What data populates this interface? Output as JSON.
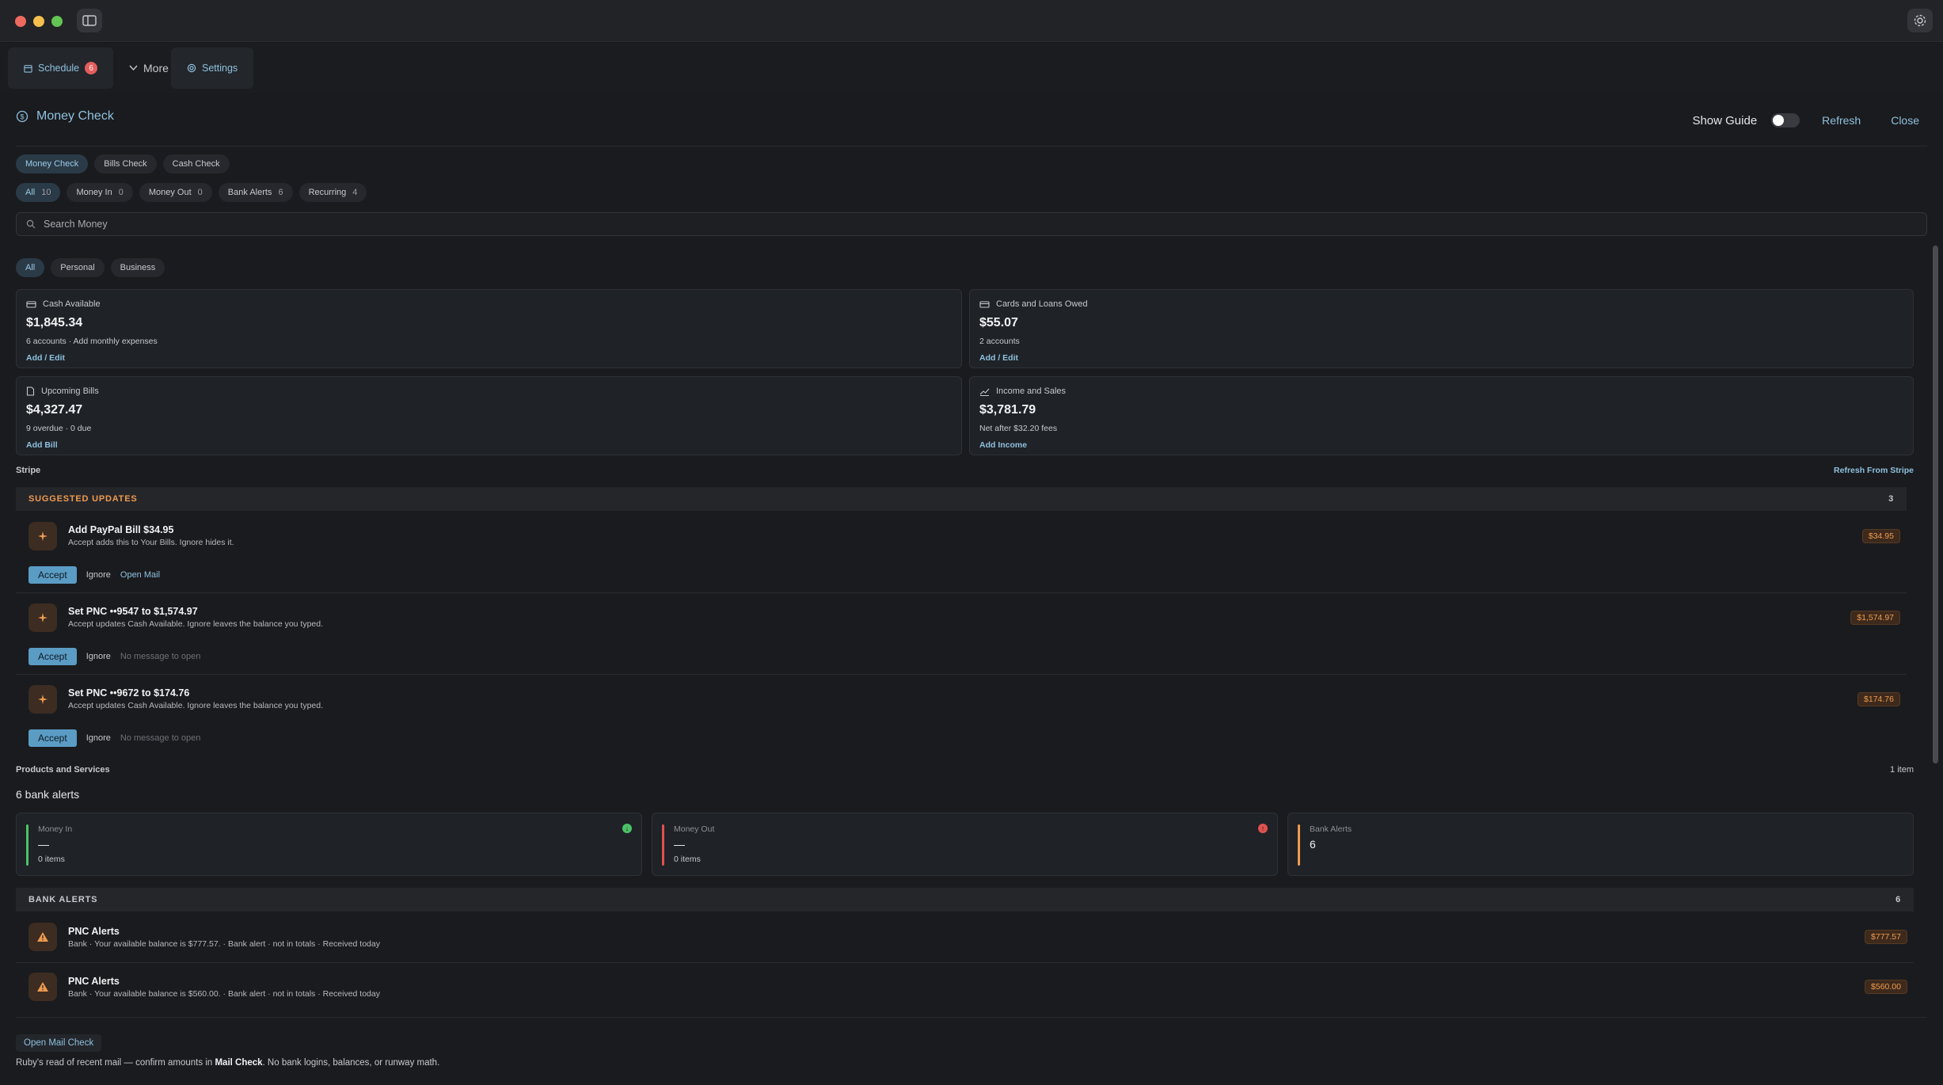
{
  "nav": {
    "tabs": [
      {
        "label": "Schedule",
        "badge": "6",
        "icon": "calendar-icon"
      },
      {
        "label": "More",
        "icon": "chevron-down-icon"
      },
      {
        "label": "Settings",
        "icon": "gear-icon"
      }
    ]
  },
  "header": {
    "title": "Money Check",
    "show_guide_label": "Show Guide",
    "refresh_label": "Refresh",
    "close_label": "Close"
  },
  "check_tabs": [
    "Money Check",
    "Bills Check",
    "Cash Check"
  ],
  "filter_pills": [
    {
      "label": "All",
      "count": "10"
    },
    {
      "label": "Money In",
      "count": "0"
    },
    {
      "label": "Money Out",
      "count": "0"
    },
    {
      "label": "Bank Alerts",
      "count": "6"
    },
    {
      "label": "Recurring",
      "count": "4"
    }
  ],
  "search": {
    "placeholder": "Search Money"
  },
  "scope_pills": [
    "All",
    "Personal",
    "Business"
  ],
  "cards": [
    {
      "title": "Cash Available",
      "value": "$1,845.34",
      "sub": "6 accounts · Add monthly expenses",
      "link": "Add / Edit",
      "icon": "wallet-icon"
    },
    {
      "title": "Cards and Loans Owed",
      "value": "$55.07",
      "sub": "2 accounts",
      "link": "Add / Edit",
      "icon": "credit-card-icon"
    },
    {
      "title": "Upcoming Bills",
      "value": "$4,327.47",
      "sub": "9 overdue · 0 due",
      "link": "Add Bill",
      "icon": "document-icon"
    },
    {
      "title": "Income and Sales",
      "value": "$3,781.79",
      "sub": "Net after $32.20 fees",
      "link": "Add Income",
      "icon": "trend-up-icon"
    }
  ],
  "stripe": {
    "label": "Stripe",
    "refresh_label": "Refresh From Stripe"
  },
  "suggested": {
    "header": "SUGGESTED UPDATES",
    "count": "3",
    "items": [
      {
        "title": "Add PayPal Bill $34.95",
        "desc": "Accept adds this to Your Bills. Ignore hides it.",
        "amount": "$34.95",
        "accept": "Accept",
        "ignore": "Ignore",
        "secondary": "Open Mail"
      },
      {
        "title": "Set PNC ••9547 to $1,574.97",
        "desc": "Accept updates Cash Available. Ignore leaves the balance you typed.",
        "amount": "$1,574.97",
        "accept": "Accept",
        "ignore": "Ignore",
        "secondary": "No message to open"
      },
      {
        "title": "Set PNC ••9672 to $174.76",
        "desc": "Accept updates Cash Available. Ignore leaves the balance you typed.",
        "amount": "$174.76",
        "accept": "Accept",
        "ignore": "Ignore",
        "secondary": "No message to open"
      }
    ]
  },
  "products": {
    "label": "Products and Services",
    "count": "1 item"
  },
  "bank_alerts_summary": "6 bank alerts",
  "stats": [
    {
      "label": "Money In",
      "value": "—",
      "sub": "0 items",
      "color": "#4cc267"
    },
    {
      "label": "Money Out",
      "value": "—",
      "sub": "0 items",
      "color": "#e0524f"
    },
    {
      "label": "Bank Alerts",
      "value": "6",
      "sub": "",
      "color": "#ee9b4f"
    }
  ],
  "bank_alerts": {
    "header": "BANK ALERTS",
    "count": "6",
    "items": [
      {
        "title": "PNC Alerts",
        "desc": "Bank · Your available balance is $777.57. · Bank alert · not in totals · Received today",
        "amount": "$777.57"
      },
      {
        "title": "PNC Alerts",
        "desc": "Bank · Your available balance is $560.00. · Bank alert · not in totals · Received today",
        "amount": "$560.00"
      }
    ]
  },
  "footer": {
    "button_label": "Open Mail Check",
    "text_before": "Ruby's read of recent mail — confirm amounts in ",
    "text_bold": "Mail Check",
    "text_after": ". No bank logins, balances, or runway math."
  },
  "colors": {
    "accent": "#8ec1de",
    "orange": "#ee9b4f",
    "accept": "#5b9cc5"
  }
}
